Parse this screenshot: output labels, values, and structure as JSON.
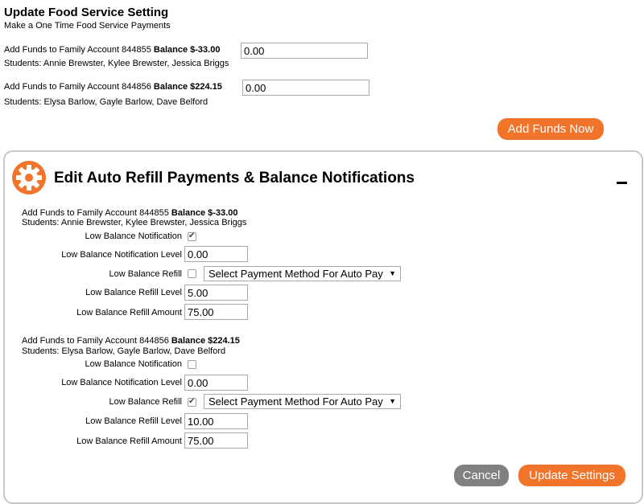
{
  "header": {
    "title": "Update Food Service Setting",
    "subtitle": "Make a One Time Food Service Payments"
  },
  "one_time": {
    "accounts": [
      {
        "prefix": "Add Funds to Family Account 844855",
        "balance": "Balance $-33.00",
        "amount": "0.00",
        "students": "Students: Annie Brewster, Kylee Brewster, Jessica Briggs"
      },
      {
        "prefix": "Add Funds to Family Account 844856",
        "balance": "Balance $224.15",
        "amount": "0.00",
        "students": "Students: Elysa Barlow, Gayle Barlow, Dave Belford"
      }
    ],
    "add_funds_label": "Add Funds Now"
  },
  "auto_refill": {
    "title": "Edit Auto Refill Payments & Balance Notifications",
    "icon": "gear-icon",
    "collapse_icon": "minus-icon",
    "labels": {
      "notification": "Low Balance Notification",
      "notification_level": "Low Balance Notification Level",
      "refill": "Low Balance Refill",
      "refill_level": "Low Balance Refill Level",
      "refill_amount": "Low Balance Refill Amount"
    },
    "accounts": [
      {
        "prefix": "Add Funds to Family Account 844855",
        "balance": "Balance $-33.00",
        "students": "Students: Annie Brewster, Kylee Brewster, Jessica Briggs",
        "notification_checked": true,
        "notification_level": "0.00",
        "refill_checked": false,
        "payment_method": "Select Payment Method For Auto Pay",
        "refill_level": "5.00",
        "refill_amount": "75.00"
      },
      {
        "prefix": "Add Funds to Family Account 844856",
        "balance": "Balance $224.15",
        "students": "Students: Elysa Barlow, Gayle Barlow, Dave Belford",
        "notification_checked": false,
        "notification_level": "0.00",
        "refill_checked": true,
        "payment_method": "Select Payment Method For Auto Pay",
        "refill_level": "10.00",
        "refill_amount": "75.00"
      }
    ],
    "cancel_label": "Cancel",
    "update_label": "Update Settings"
  },
  "colors": {
    "accent": "#f2732a",
    "cancel": "#808080",
    "panel_border": "#c8c8c8"
  }
}
